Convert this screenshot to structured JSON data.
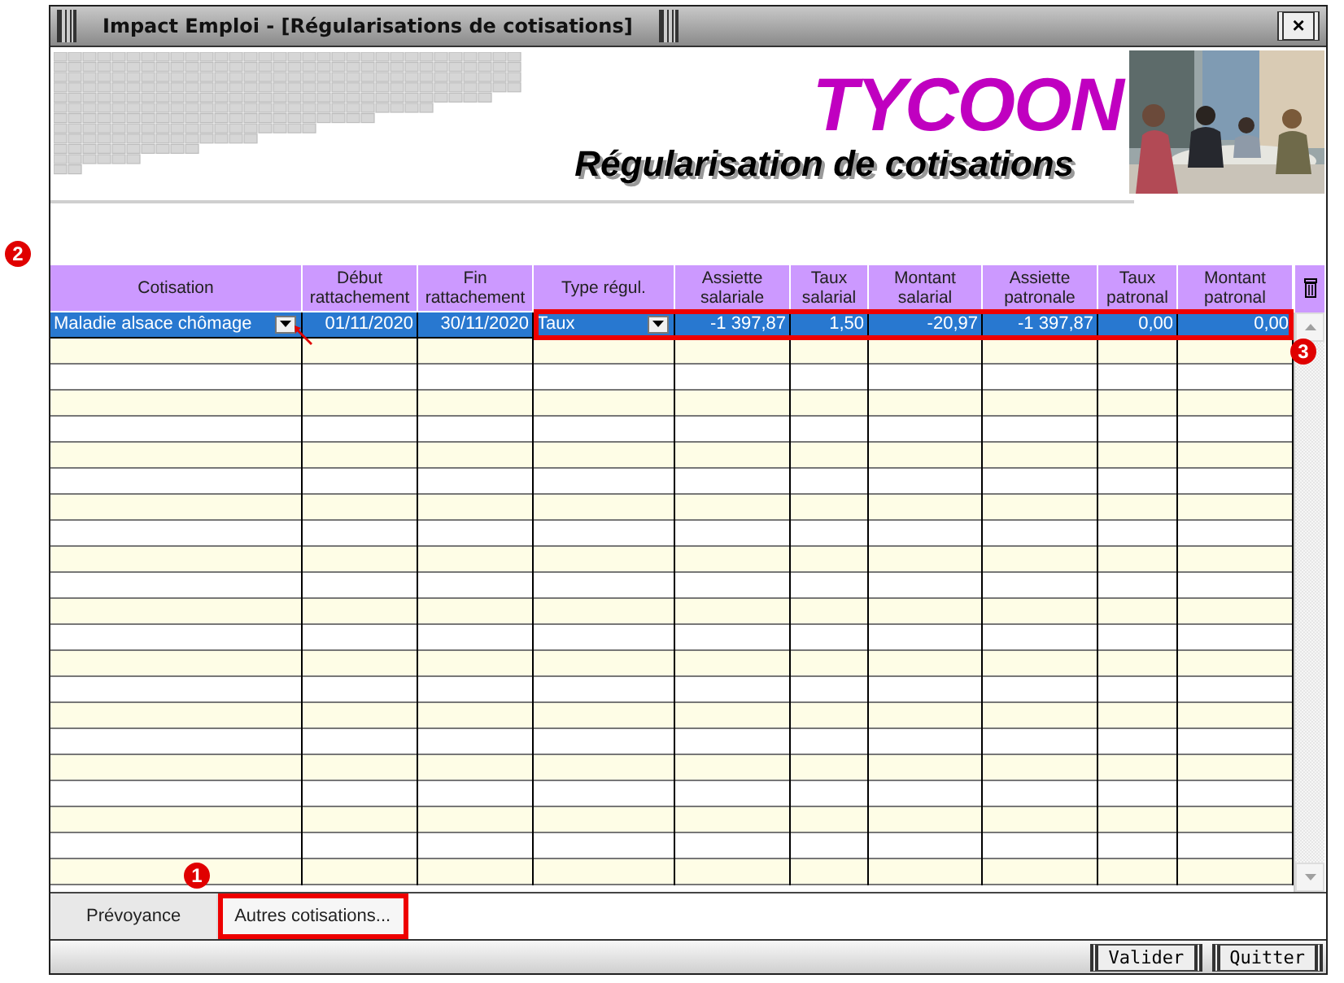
{
  "window": {
    "title": "Impact Emploi - [Régularisations de cotisations]",
    "close_glyph": "×"
  },
  "banner": {
    "brand": "TYCOON",
    "heading": "Régularisation de cotisations"
  },
  "table": {
    "columns": [
      {
        "label": "Cotisation"
      },
      {
        "label": "Début rattachement"
      },
      {
        "label": "Fin rattachement"
      },
      {
        "label": "Type régul."
      },
      {
        "label": "Assiette salariale"
      },
      {
        "label": "Taux salarial"
      },
      {
        "label": "Montant salarial"
      },
      {
        "label": "Assiette patronale"
      },
      {
        "label": "Taux patronal"
      },
      {
        "label": "Montant patronal"
      }
    ],
    "rows": [
      {
        "selected": true,
        "cells": [
          {
            "text": "Maladie alsace chômage",
            "kind": "dropdown"
          },
          {
            "text": "01/11/2020",
            "kind": "text"
          },
          {
            "text": "30/11/2020",
            "kind": "text"
          },
          {
            "text": "Taux",
            "kind": "dropdown"
          },
          {
            "text": "-1 397,87",
            "kind": "text"
          },
          {
            "text": "1,50",
            "kind": "text"
          },
          {
            "text": "-20,97",
            "kind": "text"
          },
          {
            "text": "-1 397,87",
            "kind": "text"
          },
          {
            "text": "0,00",
            "kind": "text"
          },
          {
            "text": "0,00",
            "kind": "text"
          }
        ]
      }
    ]
  },
  "tabs": [
    {
      "label": "Prévoyance",
      "selected": true
    },
    {
      "label": "Autres cotisations...",
      "selected": false
    }
  ],
  "buttons": [
    {
      "label": "Valider"
    },
    {
      "label": "Quitter"
    }
  ],
  "callouts": {
    "tabs": "1",
    "table": "2",
    "row": "3"
  }
}
